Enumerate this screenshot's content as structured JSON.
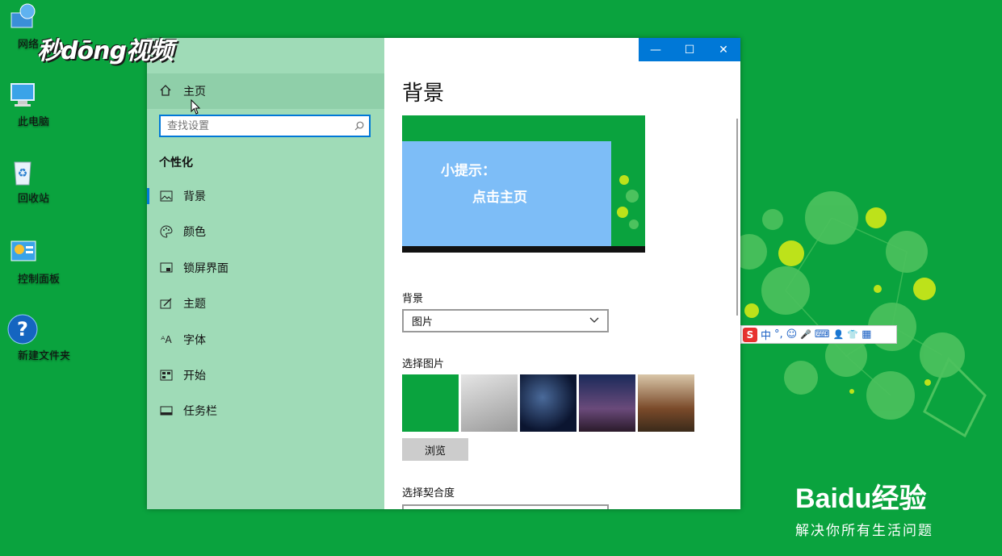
{
  "desktop": {
    "icons": [
      {
        "label": "网络",
        "icon": "network-icon"
      },
      {
        "label": "此电脑",
        "icon": "computer-icon"
      },
      {
        "label": "回收站",
        "icon": "recycle-bin-icon"
      },
      {
        "label": "控制面板",
        "icon": "control-panel-icon"
      },
      {
        "label": "新建文件夹",
        "icon": "help-icon"
      }
    ]
  },
  "watermark": {
    "top_text": "秒dōng视频",
    "brand": "Baidu经验",
    "slogan": "解决你所有生活问题"
  },
  "ime": {
    "items": [
      "中",
      "°,",
      "☺",
      "🎤",
      "⌨",
      "👤",
      "👕",
      "▦"
    ]
  },
  "window": {
    "controls": {
      "minimize": "—",
      "maximize": "☐",
      "close": "✕"
    },
    "sidebar": {
      "home_label": "主页",
      "search_placeholder": "查找设置",
      "section_title": "个性化",
      "items": [
        {
          "label": "背景",
          "icon": "picture-icon",
          "active": true
        },
        {
          "label": "颜色",
          "icon": "palette-icon",
          "active": false
        },
        {
          "label": "锁屏界面",
          "icon": "lock-screen-icon",
          "active": false
        },
        {
          "label": "主题",
          "icon": "theme-brush-icon",
          "active": false
        },
        {
          "label": "字体",
          "icon": "font-icon",
          "active": false
        },
        {
          "label": "开始",
          "icon": "start-icon",
          "active": false
        },
        {
          "label": "任务栏",
          "icon": "taskbar-icon",
          "active": false
        }
      ]
    },
    "content": {
      "page_title": "背景",
      "preview": {
        "hint_line1": "小提示：",
        "hint_line2": "点击主页"
      },
      "background_label": "背景",
      "background_value": "图片",
      "choose_picture_label": "选择图片",
      "browse_label": "浏览",
      "fit_label": "选择契合度"
    }
  },
  "colors": {
    "desktop": "#0aa33e",
    "sidebar": "#9fdbb7",
    "accent": "#0078d7",
    "hint_box": "#7dbdf7"
  }
}
